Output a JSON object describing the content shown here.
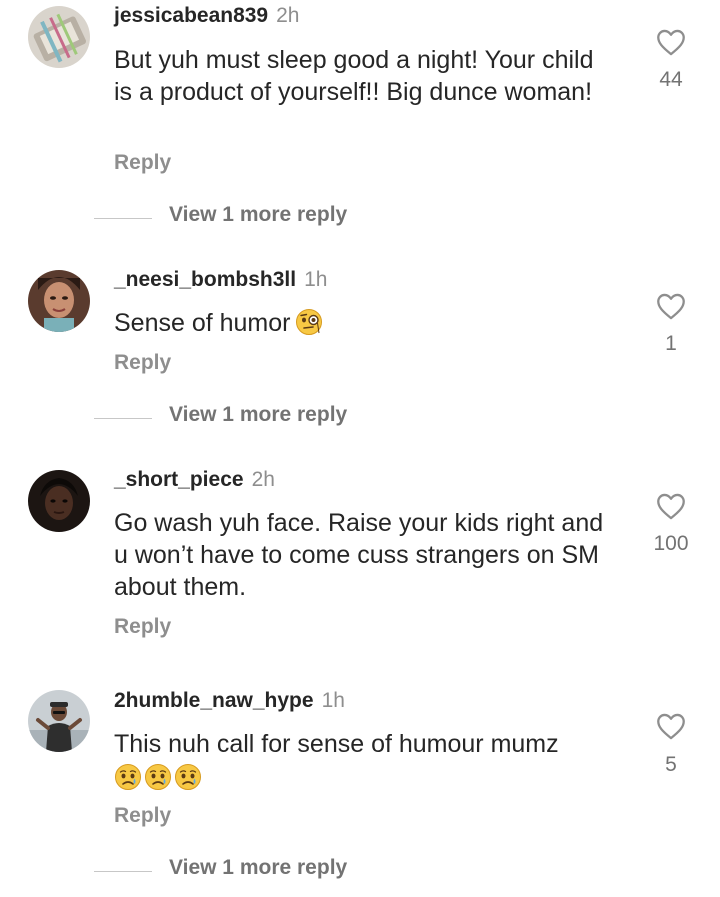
{
  "comments": [
    {
      "username": "jessicabean839",
      "time": "2h",
      "text": "But yuh must sleep good a night! Your child is a product of yourself!! Big dunce woman!",
      "reply_label": "Reply",
      "likes": "44",
      "more_replies": "View 1 more reply"
    },
    {
      "username": "_neesi_bombsh3ll",
      "time": "1h",
      "text": "Sense of humor",
      "emoji": "face-with-monocle",
      "reply_label": "Reply",
      "likes": "1",
      "more_replies": "View 1 more reply"
    },
    {
      "username": "_short_piece",
      "time": "2h",
      "text": "Go wash yuh face. Raise your kids right and u won’t have to come cuss strangers on SM about them.",
      "reply_label": "Reply",
      "likes": "100"
    },
    {
      "username": "2humble_naw_hype",
      "time": "1h",
      "text": "This nuh call for sense of humour mumz",
      "emoji": "crying-face x3",
      "reply_label": "Reply",
      "likes": "5",
      "more_replies": "View 1 more reply"
    }
  ]
}
